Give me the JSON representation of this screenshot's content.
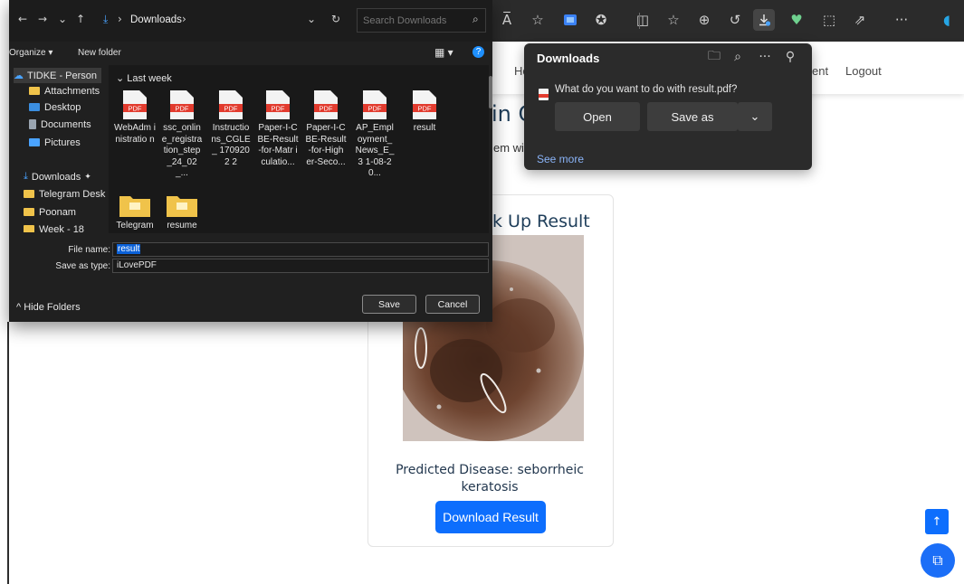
{
  "browser": {
    "toolbar_icons": [
      "read-aloud-icon",
      "favorite-star-icon",
      "extension-icon",
      "copilot-icon",
      "split-screen-icon",
      "favorites-icon",
      "collections-icon",
      "history-icon",
      "downloads-icon",
      "performance-icon",
      "screenshot-icon",
      "share-icon",
      "more-icon"
    ],
    "more_label": "···",
    "read_aloud_label": "A̅",
    "accent": "#0d6efd"
  },
  "site": {
    "nav_home_partial": "Ho",
    "nav_partial": "ent",
    "nav_logout": "Logout",
    "heading_partial": "in C",
    "subtext_partial": "em wi",
    "card_title_partial": "k Up Result",
    "predicted_label": "Predicted Disease: seborrheic keratosis",
    "download_button": "Download Result",
    "back_to_top": "↑",
    "chat_icon": "⧉"
  },
  "downloads": {
    "title": "Downloads",
    "question": "What do you want to do with result.pdf?",
    "open": "Open",
    "save_as": "Save as",
    "see_more": "See more"
  },
  "dialog": {
    "address": "Downloads",
    "address_separator": "›",
    "search_placeholder": "Search Downloads",
    "organize": "Organize ▾",
    "new_folder": "New folder",
    "nav": [
      {
        "label": "TIDKE - Person",
        "icon": "cloud-icon"
      },
      {
        "label": "Attachments",
        "icon": "folder-icon"
      },
      {
        "label": "Desktop",
        "icon": "desktop-icon"
      },
      {
        "label": "Documents",
        "icon": "documents-icon"
      },
      {
        "label": "Pictures",
        "icon": "pictures-icon"
      },
      {
        "label": "Downloads",
        "icon": "download-icon"
      },
      {
        "label": "Telegram Desk",
        "icon": "folder-icon"
      },
      {
        "label": "Poonam",
        "icon": "folder-icon"
      },
      {
        "label": "Week - 18",
        "icon": "folder-icon"
      }
    ],
    "group_label": "Last week",
    "files": [
      {
        "name": "WebAdm inistratio n",
        "type": "pdf"
      },
      {
        "name": "ssc_onlin e_registra tion_step _24_02_...",
        "type": "pdf"
      },
      {
        "name": "Instructio ns_CGLE_ 1709202 2",
        "type": "pdf"
      },
      {
        "name": "Paper-I-C BE-Result -for-Matr iculatio...",
        "type": "pdf"
      },
      {
        "name": "Paper-I-C BE-Result -for-High er-Seco...",
        "type": "pdf"
      },
      {
        "name": "AP_Empl oyment_ News_E_3 1-08-20...",
        "type": "pdf"
      },
      {
        "name": "result",
        "type": "pdf"
      },
      {
        "name": "Telegram",
        "type": "folder"
      },
      {
        "name": "resume",
        "type": "folder"
      }
    ],
    "pdf_label": "PDF",
    "file_name_label": "File name:",
    "file_name_value": "result",
    "save_type_label": "Save as type:",
    "save_type_value": "iLovePDF",
    "hide_folders": "^ Hide Folders",
    "save_button": "Save",
    "cancel_button": "Cancel"
  }
}
